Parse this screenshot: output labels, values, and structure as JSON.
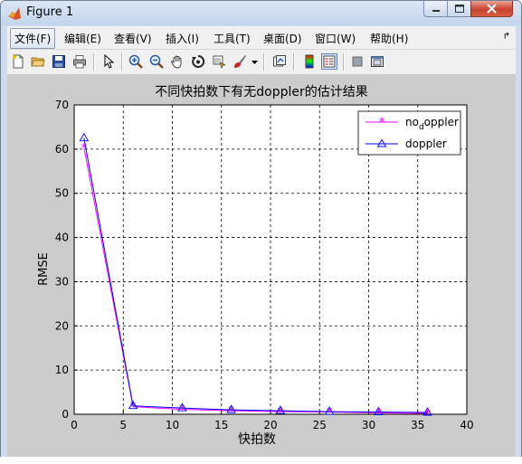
{
  "window": {
    "title": "Figure 1"
  },
  "menu": {
    "items": [
      "文件(F)",
      "编辑(E)",
      "查看(V)",
      "插入(I)",
      "工具(T)",
      "桌面(D)",
      "窗口(W)",
      "帮助(H)"
    ]
  },
  "toolbar": {
    "icons": [
      "new-file-icon",
      "open-folder-icon",
      "save-icon",
      "print-icon",
      "pointer-icon",
      "zoom-in-icon",
      "zoom-out-icon",
      "pan-hand-icon",
      "rotate-3d-icon",
      "data-cursor-icon",
      "brush-icon",
      "brush-dropdown-icon",
      "link-plot-icon",
      "colorbar-icon",
      "legend-icon",
      "hide-plot-tools-icon",
      "show-plot-tools-icon"
    ]
  },
  "colors": {
    "no_doppler": "#ff00ff",
    "doppler": "#0000ff",
    "figure_bg": "#cccccc"
  },
  "chart_data": {
    "type": "line",
    "title": "不同快拍数下有无doppler的估计结果",
    "xlabel": "快拍数",
    "ylabel": "RMSE",
    "xlim": [
      0,
      40
    ],
    "ylim": [
      0,
      70
    ],
    "xticks": [
      0,
      5,
      10,
      15,
      20,
      25,
      30,
      35,
      40
    ],
    "yticks": [
      0,
      10,
      20,
      30,
      40,
      50,
      60,
      70
    ],
    "grid": true,
    "legend_position": "top-right",
    "series": [
      {
        "name": "no_doppler",
        "marker": "asterisk",
        "color": "#ff00ff",
        "x": [
          1,
          6,
          11,
          16,
          21,
          26,
          31,
          36
        ],
        "y": [
          60.3,
          1.7,
          1.1,
          0.8,
          0.6,
          0.5,
          0.3,
          0.2
        ]
      },
      {
        "name": "doppler",
        "marker": "triangle",
        "color": "#0000ff",
        "x": [
          1,
          6,
          11,
          16,
          21,
          26,
          31,
          36
        ],
        "y": [
          62.5,
          1.9,
          1.4,
          1.0,
          0.8,
          0.6,
          0.5,
          0.4
        ]
      }
    ]
  }
}
